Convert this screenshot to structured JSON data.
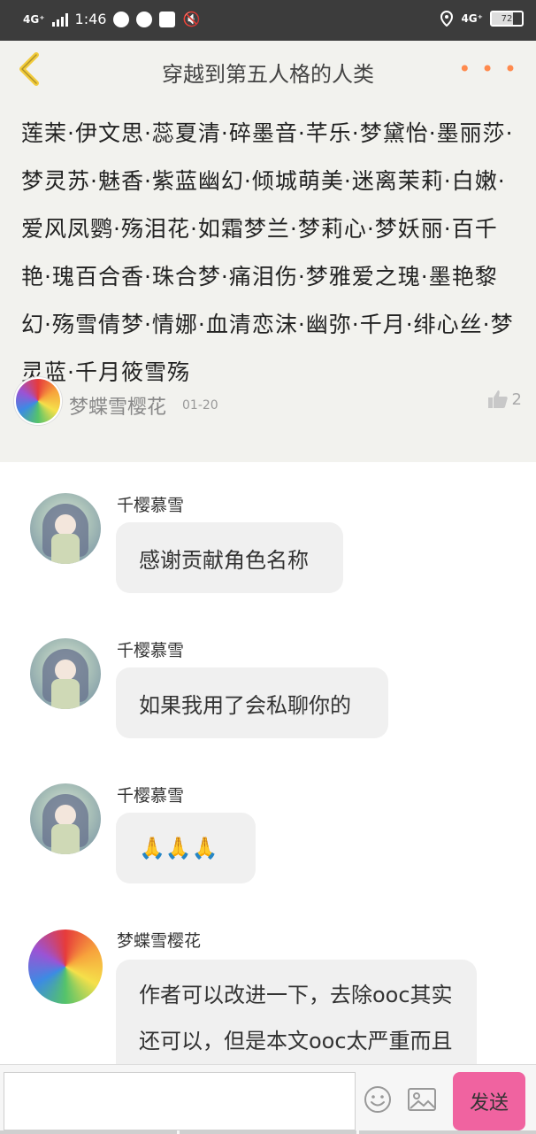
{
  "status_bar": {
    "network_left": "4G⁺",
    "time": "1:46",
    "network_right": "4G⁺",
    "battery": "72"
  },
  "header": {
    "title": "穿越到第五人格的人类",
    "more": "• • •"
  },
  "post": {
    "body": "莲茉·伊文思·蕊夏清·碎墨音·芊乐·梦黛怡·墨丽莎·梦灵苏·魅香·紫蓝幽幻·倾城萌美·迷离茉莉·白嫩·爱风凤鹦·殇泪花·如霜梦兰·梦莉心·梦妖丽·百千艳·瑰百合香·珠合梦·痛泪伤·梦雅爱之瑰·墨艳黎幻·殇雪倩梦·情娜·血清恋沫·幽弥·千月·绯心丝·梦灵蓝·千月筱雪殇",
    "author": "梦蝶雪樱花",
    "date": "01-20",
    "likes": "2"
  },
  "comments": [
    {
      "name": "千樱慕雪",
      "text": "感谢贡献角色名称"
    },
    {
      "name": "千樱慕雪",
      "text": "如果我用了会私聊你的"
    },
    {
      "name": "千樱慕雪",
      "text": "🙏🙏🙏"
    },
    {
      "name": "梦蝶雪樱花",
      "text": "作者可以改进一下，去除ooc其实还可以，但是本文ooc太严重而且再"
    }
  ],
  "bottom_bar": {
    "input_placeholder": "",
    "send_label": "发送"
  },
  "icons": {
    "back": "chevron-left-icon",
    "more": "more-dots-icon",
    "like": "thumbs-up-icon",
    "emoji": "smiley-icon",
    "image": "image-icon"
  },
  "colors": {
    "back_arrow": "#f2cb3a",
    "more_dots": "#ff8a4d",
    "send_button": "#f063a0",
    "header_bg": "#f2f2ee"
  }
}
